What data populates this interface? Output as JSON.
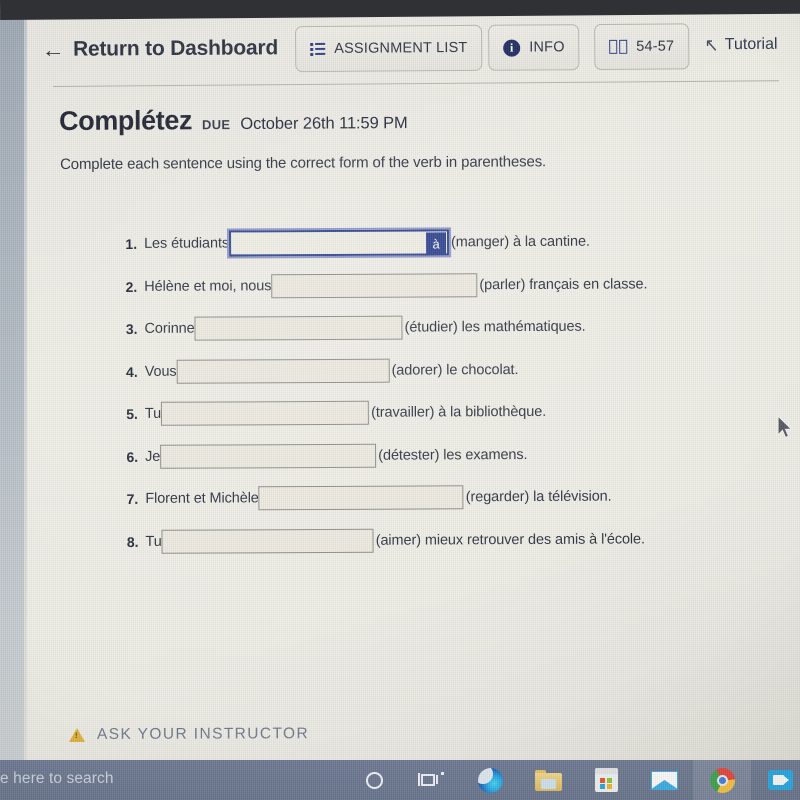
{
  "header": {
    "return_label": "Return to Dashboard",
    "back_arrow_glyph": "←",
    "buttons": [
      {
        "id": "assignment-list",
        "label": "ASSIGNMENT LIST",
        "icon": "list-icon"
      },
      {
        "id": "info",
        "label": "INFO",
        "icon": "info-circle-icon",
        "icon_glyph": "i"
      },
      {
        "id": "pages",
        "label": "54-57",
        "icon": "open-book-icon"
      }
    ],
    "tutorial_label": "Tutorial",
    "tutorial_cursor_glyph": "↖"
  },
  "title": {
    "name": "Complétez",
    "due_label": "DUE",
    "due_date": "October 26th 11:59 PM"
  },
  "instructions": "Complete each sentence using the correct form of the verb in parentheses.",
  "exercises": [
    {
      "number": "1.",
      "prefix": "Les étudiants",
      "answer": "",
      "suffix": "(manger) à la cantine.",
      "blank_width": 220,
      "focused": true,
      "accent_char": "à"
    },
    {
      "number": "2.",
      "prefix": "Hélène et moi, nous",
      "answer": "",
      "suffix": "(parler) français en classe.",
      "blank_width": 206,
      "focused": false
    },
    {
      "number": "3.",
      "prefix": "Corinne",
      "answer": "",
      "suffix": "(étudier) les mathématiques.",
      "blank_width": 208,
      "focused": false
    },
    {
      "number": "4.",
      "prefix": "Vous",
      "answer": "",
      "suffix": "(adorer) le chocolat.",
      "blank_width": 213,
      "focused": false
    },
    {
      "number": "5.",
      "prefix": "Tu",
      "answer": "",
      "suffix": "(travailler) à la bibliothèque.",
      "blank_width": 208,
      "focused": false
    },
    {
      "number": "6.",
      "prefix": "Je",
      "answer": "",
      "suffix": "(détester) les examens.",
      "blank_width": 216,
      "focused": false
    },
    {
      "number": "7.",
      "prefix": "Florent et Michèle",
      "answer": "",
      "suffix": "(regarder) la télévision.",
      "blank_width": 205,
      "focused": false
    },
    {
      "number": "8.",
      "prefix": "Tu",
      "answer": "",
      "suffix": "(aimer) mieux retrouver des amis à l'école.",
      "blank_width": 212,
      "focused": false
    }
  ],
  "footer": {
    "ask_instructor_label": "ASK YOUR INSTRUCTOR",
    "warning_icon": "warning-triangle-icon"
  },
  "taskbar": {
    "search_text": "e here to search",
    "icons": [
      {
        "id": "cortana",
        "name": "cortana-icon"
      },
      {
        "id": "taskview",
        "name": "task-view-icon"
      },
      {
        "id": "edge",
        "name": "edge-browser-icon"
      },
      {
        "id": "explorer",
        "name": "file-explorer-icon"
      },
      {
        "id": "store",
        "name": "microsoft-store-icon"
      },
      {
        "id": "mail",
        "name": "mail-icon"
      },
      {
        "id": "chrome",
        "name": "chrome-browser-icon"
      },
      {
        "id": "video",
        "name": "video-app-icon"
      }
    ]
  },
  "colors": {
    "page_background": "#eeede6",
    "accent_blue": "#2b3a85",
    "taskbar": "#6e7a93",
    "focus_border": "#2c3f8f",
    "warning_yellow": "#e3b23c",
    "muted_text": "#6f7a8c"
  }
}
